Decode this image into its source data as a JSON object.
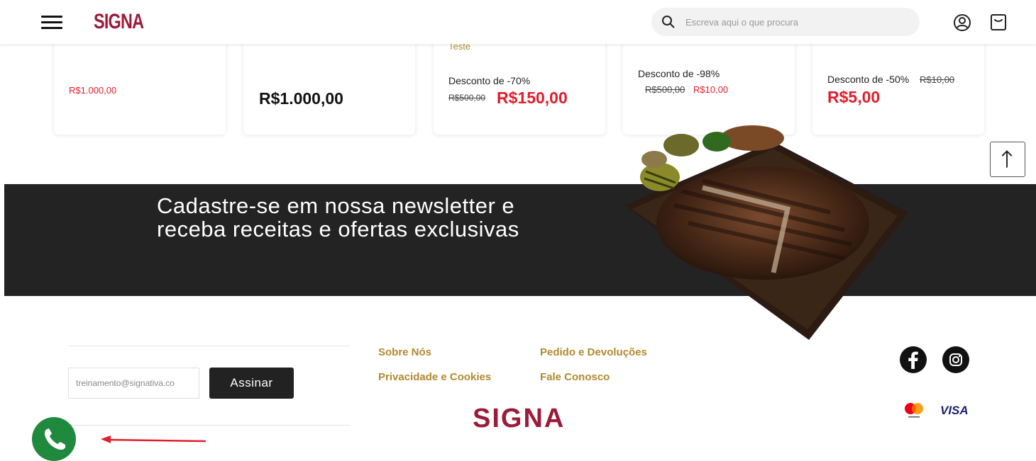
{
  "header": {
    "logo": "SIGNA",
    "search_placeholder": "Escreva aqui o que procura"
  },
  "products": [
    {
      "price": "R$1.000,00"
    },
    {
      "price": "R$1.000,00"
    },
    {
      "name": "Teste",
      "discount": "Desconto de -70%",
      "old_price": "R$500,00",
      "price": "R$150,00"
    },
    {
      "discount": "Desconto de -98%",
      "old_price": "R$500,00",
      "price": "R$10,00"
    },
    {
      "discount": "Desconto de -50%",
      "old_price": "R$10,00",
      "price": "R$5,00"
    }
  ],
  "newsletter": {
    "text": "Cadastre-se em nossa newsletter e receba receitas e ofertas exclusivas",
    "email_value": "treinamento@signativa.co",
    "button_label": "Assinar"
  },
  "footer": {
    "links": [
      "Sobre Nós",
      "Pedido e Devoluções",
      "Privacidade e Cookies",
      "Fale Conosco"
    ],
    "logo": "SIGNA",
    "payment": {
      "visa": "VISA"
    }
  },
  "colors": {
    "brand": "#9b1b3a",
    "accent_gold": "#b08a2e",
    "price_red": "#e21d2b",
    "band": "#232323",
    "whatsapp": "#1f8a3e"
  },
  "icons": [
    "menu-icon",
    "search-icon",
    "user-icon",
    "cart-icon",
    "arrow-up-icon",
    "facebook-icon",
    "instagram-icon",
    "mastercard-icon",
    "whatsapp-icon"
  ]
}
